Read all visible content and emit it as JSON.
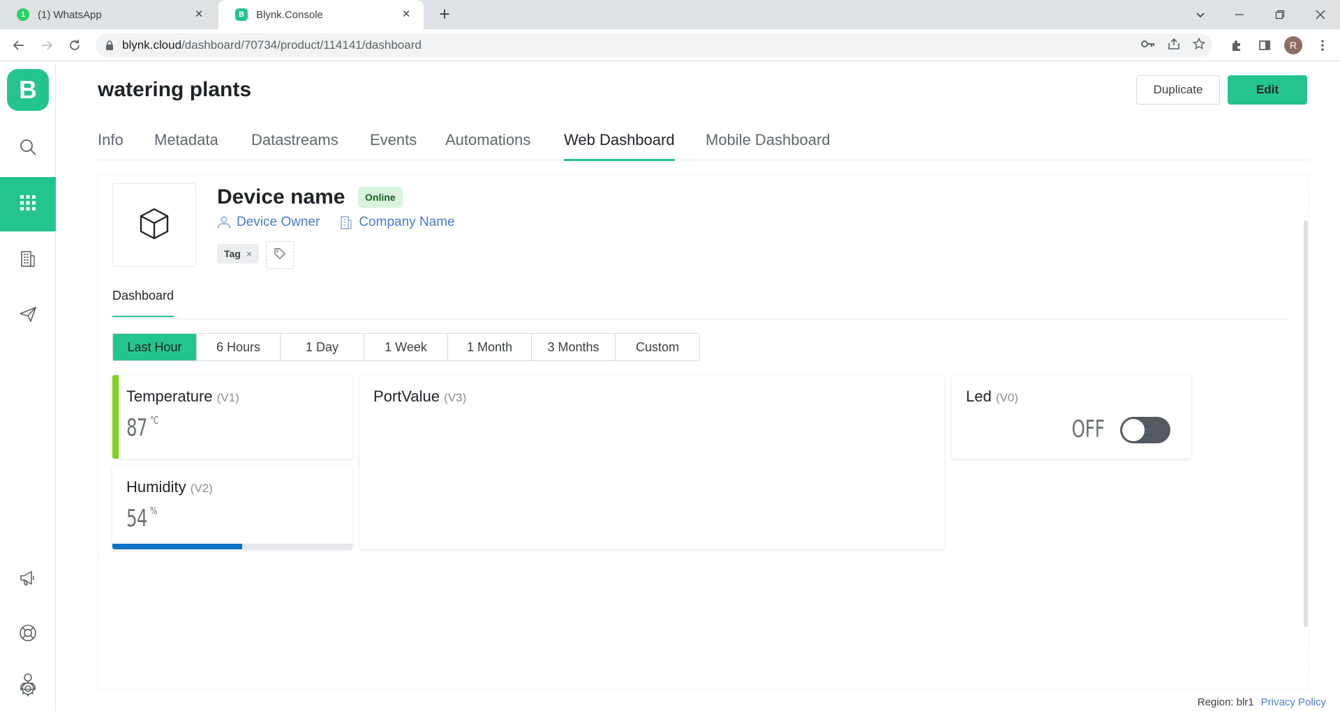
{
  "browser": {
    "tabs": [
      {
        "title": "(1) WhatsApp",
        "badge": "1"
      },
      {
        "title": "Blynk.Console",
        "badge": "B"
      }
    ],
    "address": {
      "host": "blynk.cloud",
      "path": "/dashboard/70734/product/114141/dashboard"
    },
    "profile_initial": "R"
  },
  "app": {
    "logo": "B",
    "sidebar": [
      {
        "icon": "search-icon"
      },
      {
        "icon": "grid-icon",
        "active": true
      },
      {
        "icon": "building-icon"
      },
      {
        "icon": "paper-plane-icon"
      },
      {
        "icon": "megaphone-icon"
      },
      {
        "icon": "lifebuoy-icon"
      },
      {
        "icon": "gear-icon"
      },
      {
        "icon": "user-icon"
      }
    ],
    "accent": "#23c48e"
  },
  "header": {
    "title": "watering plants",
    "duplicate_label": "Duplicate",
    "edit_label": "Edit"
  },
  "tabs": [
    "Info",
    "Metadata",
    "Datastreams",
    "Events",
    "Automations",
    "Web Dashboard",
    "Mobile Dashboard"
  ],
  "active_tab": "Web Dashboard",
  "device": {
    "name": "Device name",
    "status": "Online",
    "owner": "Device Owner",
    "company": "Company Name",
    "tag": "Tag"
  },
  "subtab": "Dashboard",
  "ranges": [
    "Last Hour",
    "6 Hours",
    "1 Day",
    "1 Week",
    "1 Month",
    "3 Months",
    "Custom"
  ],
  "active_range": "Last Hour",
  "widgets": {
    "temperature": {
      "title": "Temperature",
      "pin": "(V1)",
      "value": "87",
      "unit": "°C",
      "color": "#7ed321"
    },
    "humidity": {
      "title": "Humidity",
      "pin": "(V2)",
      "value": "54",
      "unit": "%",
      "level": 0.54,
      "color": "#0d74c8"
    },
    "portvalue": {
      "title": "PortValue",
      "pin": "(V3)"
    },
    "led": {
      "title": "Led",
      "pin": "(V0)",
      "state": "OFF"
    }
  },
  "footer": {
    "region": "Region: blr1",
    "privacy": "Privacy Policy"
  }
}
